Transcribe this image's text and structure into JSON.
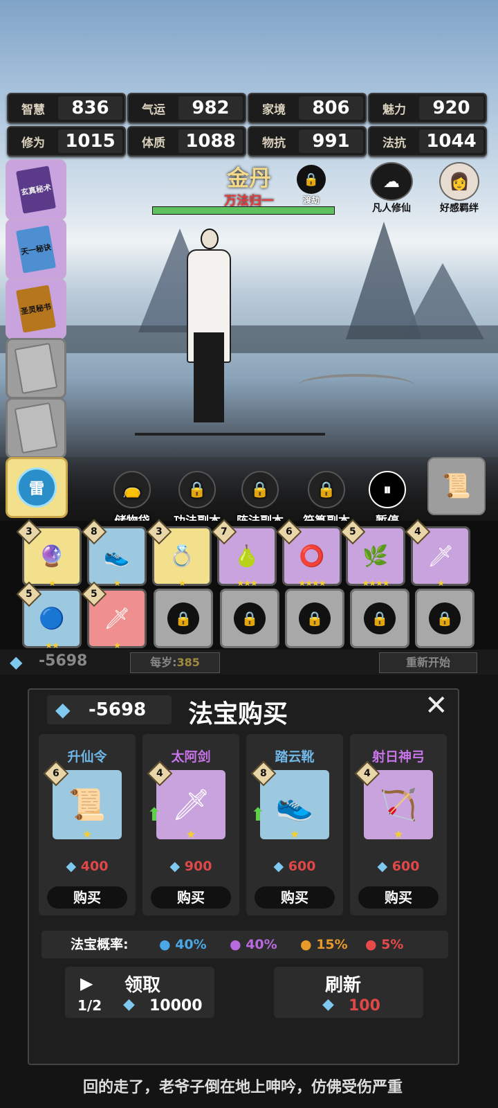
{
  "stats": [
    {
      "label": "智慧",
      "value": "836"
    },
    {
      "label": "气运",
      "value": "982"
    },
    {
      "label": "家境",
      "value": "806"
    },
    {
      "label": "魅力",
      "value": "920"
    },
    {
      "label": "修为",
      "value": "1015"
    },
    {
      "label": "体质",
      "value": "1088"
    },
    {
      "label": "物抗",
      "value": "991"
    },
    {
      "label": "法抗",
      "value": "1044"
    }
  ],
  "realm": {
    "title": "金丹",
    "subtitle": "万法归一",
    "lock_label": "渡劫",
    "progress": 1.0
  },
  "top_right": {
    "mortal": "凡人修仙",
    "affinity": "好感羁绊"
  },
  "books": [
    "玄真秘术",
    "天一秘诀",
    "圣灵秘书"
  ],
  "skill_btn": "雷",
  "menu": [
    "储物袋",
    "功法副本",
    "阵法副本",
    "符箓副本",
    "暂停"
  ],
  "items": [
    {
      "lvl": "3",
      "icon": "🔮",
      "stars": "★",
      "color": "#f3e08d"
    },
    {
      "lvl": "8",
      "icon": "👟",
      "stars": "★",
      "color": "#9cc8e0"
    },
    {
      "lvl": "3",
      "icon": "💍",
      "stars": "★",
      "color": "#f3e08d"
    },
    {
      "lvl": "7",
      "icon": "🍐",
      "stars": "★★★",
      "color": "#c9a3dd"
    },
    {
      "lvl": "6",
      "icon": "⭕",
      "stars": "★★★★",
      "color": "#c9a3dd"
    },
    {
      "lvl": "5",
      "icon": "🌿",
      "stars": "★★★★",
      "color": "#c9a3dd"
    },
    {
      "lvl": "4",
      "icon": "🗡",
      "stars": "★",
      "color": "#c9a3dd"
    },
    {
      "lvl": "5",
      "icon": "🔵",
      "stars": "★★",
      "color": "#9cc8e0"
    },
    {
      "lvl": "5",
      "icon": "🗡",
      "stars": "★",
      "color": "#f08f8f"
    }
  ],
  "status": {
    "gems": "-5698",
    "per_year_label": "每岁:",
    "per_year": "385",
    "restart": "重新开始"
  },
  "dialog": {
    "gems": "-5698",
    "title": "法宝购买",
    "cards": [
      {
        "name": "升仙令",
        "lvl": "6",
        "icon": "📜",
        "price": "400",
        "buy": "购买",
        "name_color": "#6fb8e8",
        "bg": "#9cc8e0",
        "up": false
      },
      {
        "name": "太阿剑",
        "lvl": "4",
        "icon": "🗡",
        "price": "900",
        "buy": "购买",
        "name_color": "#c774e8",
        "bg": "#c9a3dd",
        "up": true
      },
      {
        "name": "踏云靴",
        "lvl": "8",
        "icon": "👟",
        "price": "600",
        "buy": "购买",
        "name_color": "#6fb8e8",
        "bg": "#9cc8e0",
        "up": true
      },
      {
        "name": "射日神弓",
        "lvl": "4",
        "icon": "🏹",
        "price": "600",
        "buy": "购买",
        "name_color": "#c774e8",
        "bg": "#c9a3dd",
        "up": false
      }
    ],
    "prob_label": "法宝概率:",
    "probs": [
      {
        "text": "40%",
        "color": "#4aa8e8"
      },
      {
        "text": "40%",
        "color": "#b86ae0"
      },
      {
        "text": "15%",
        "color": "#e89a2a"
      },
      {
        "text": "5%",
        "color": "#e84a4a"
      }
    ],
    "claim_label": "领取",
    "claim_count": "1/2",
    "claim_amount": "10000",
    "refresh_label": "刷新",
    "refresh_cost": "100"
  },
  "story": "回的走了，老爷子倒在地上呻吟，仿佛受伤严重"
}
